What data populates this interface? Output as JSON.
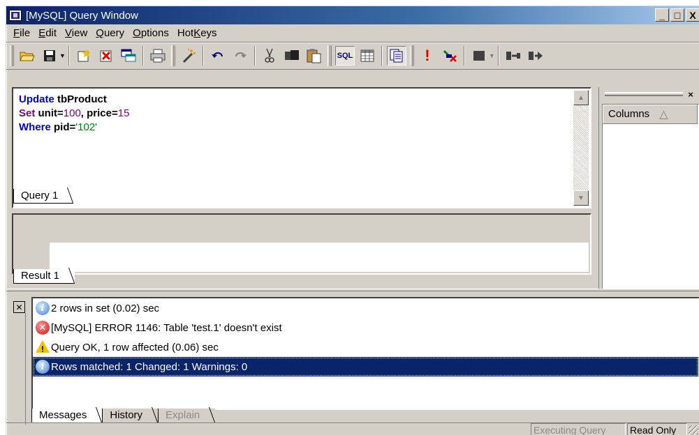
{
  "window": {
    "title": "[MySQL] Query Window"
  },
  "title_buttons": {
    "minimize": "_",
    "maximize": "□",
    "close": "X"
  },
  "menu": [
    {
      "label": "File",
      "hotkey": "F"
    },
    {
      "label": "Edit",
      "hotkey": "E"
    },
    {
      "label": "View",
      "hotkey": "V"
    },
    {
      "label": "Query",
      "hotkey": "Q"
    },
    {
      "label": "Options",
      "hotkey": "O"
    },
    {
      "label": "HotKeys",
      "hotkey": "K"
    }
  ],
  "toolbar": {
    "icons": [
      "open-folder-icon",
      "save-icon",
      "new-query-icon",
      "delete-query-icon",
      "window-icon",
      "print-icon",
      "wizard-wand-icon",
      "undo-icon",
      "redo-icon",
      "cut-icon",
      "copy-icon",
      "paste-icon",
      "sql-icon",
      "grid-icon",
      "results-pane-icon",
      "execute-icon",
      "stop-icon",
      "stop-square-icon",
      "commit-icon",
      "rollback-icon"
    ],
    "sql_label": "SQL"
  },
  "query": {
    "line1": {
      "kw": "Update",
      "rest": " tbProduct"
    },
    "line2": {
      "kw": "Set",
      "a": "  unit=",
      "b": "100",
      "c": ", price=",
      "d": "15"
    },
    "line3": {
      "kw": "Where",
      "a": " pid=",
      "b": "'102'"
    },
    "tab": "Query 1"
  },
  "result": {
    "tab": "Result 1"
  },
  "columns_panel": {
    "header": "Columns",
    "sort_glyph": "△"
  },
  "messages": [
    {
      "type": "info",
      "text": "2 rows in set (0.02) sec"
    },
    {
      "type": "error",
      "text": "[MySQL] ERROR 1146: Table 'test.1' doesn't exist"
    },
    {
      "type": "warning",
      "text": "Query OK, 1 row affected (0.06) sec"
    },
    {
      "type": "info",
      "text": "Rows matched: 1 Changed: 1 Warnings: 0",
      "selected": true
    }
  ],
  "message_tabs": [
    {
      "label": "Messages",
      "state": "active"
    },
    {
      "label": "History",
      "state": "inactive"
    },
    {
      "label": "Explain",
      "state": "disabled"
    }
  ],
  "status": {
    "executing": "Executing Query",
    "mode": "Read Only"
  }
}
